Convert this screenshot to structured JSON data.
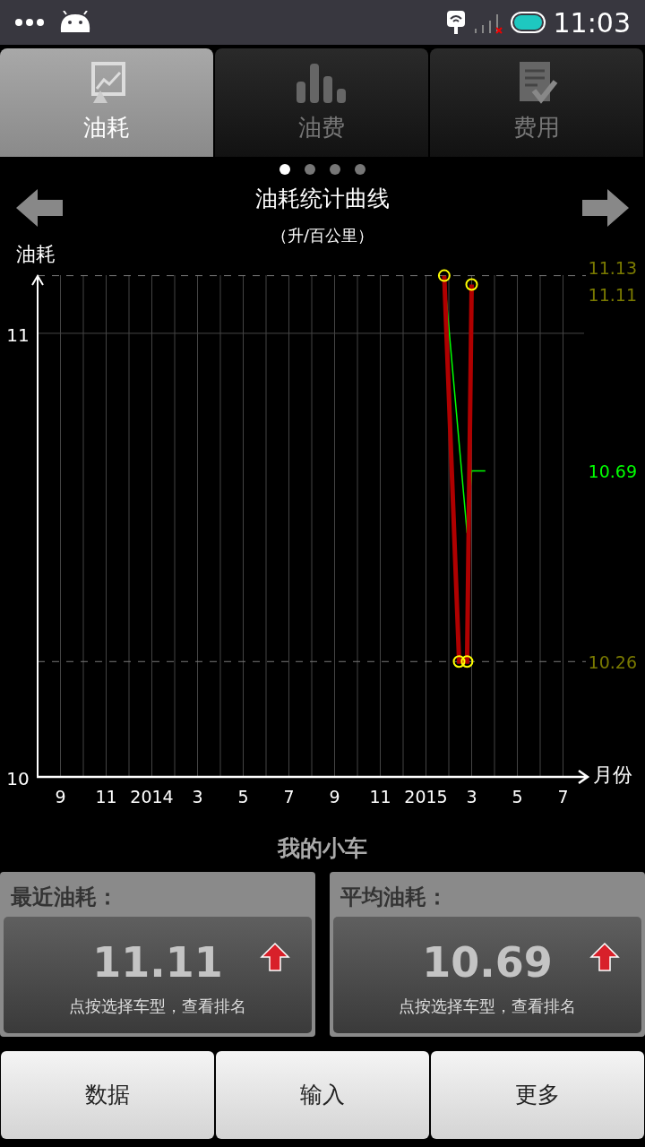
{
  "status_bar": {
    "time": "11:03"
  },
  "tabs": [
    {
      "label": "油耗",
      "selected": true
    },
    {
      "label": "油费",
      "selected": false
    },
    {
      "label": "费用",
      "selected": false
    }
  ],
  "pager": [
    {
      "selected": true
    },
    {
      "selected": false
    },
    {
      "selected": false
    },
    {
      "selected": false
    }
  ],
  "chart_header": {
    "title": "油耗统计曲线",
    "subtitle": "（升/百公里）"
  },
  "chart": {
    "y_axis_title": "油耗",
    "x_axis_title": "月份",
    "y_ticks": [
      "11",
      "10"
    ],
    "x_labels": [
      "9",
      "11",
      "2014",
      "3",
      "5",
      "7",
      "9",
      "11",
      "2015",
      "3",
      "5",
      "7"
    ],
    "value_labels": [
      {
        "text": "11.13",
        "kind": "max",
        "color": "#7a7a00"
      },
      {
        "text": "11.11",
        "kind": "latest",
        "color": "#7a7a00"
      },
      {
        "text": "10.69",
        "kind": "average",
        "color": "#00ff00"
      },
      {
        "text": "10.26",
        "kind": "min",
        "color": "#7a7a00"
      }
    ]
  },
  "car_name": "我的小车",
  "cards": [
    {
      "title": "最近油耗：",
      "value": "11.11",
      "hint": "点按选择车型，查看排名"
    },
    {
      "title": "平均油耗：",
      "value": "10.69",
      "hint": "点按选择车型，查看排名"
    }
  ],
  "buttons": [
    "数据",
    "输入",
    "更多"
  ]
}
